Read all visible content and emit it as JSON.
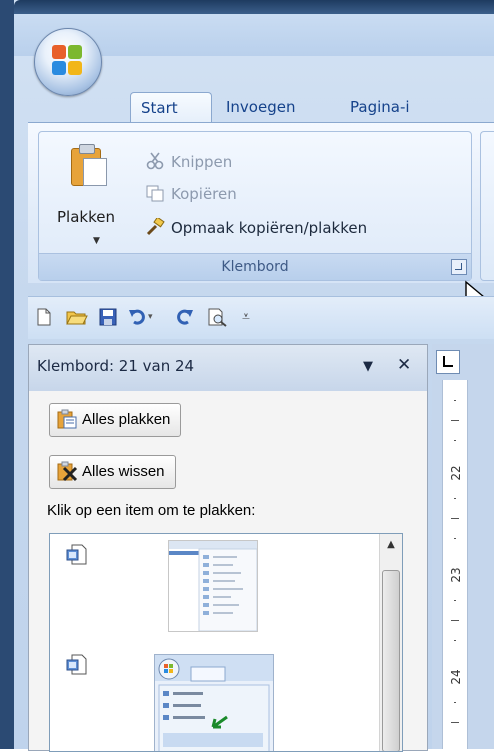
{
  "ribbon": {
    "tabs": [
      {
        "label": "Start",
        "active": true
      },
      {
        "label": "Invoegen",
        "active": false
      },
      {
        "label": "Pagina-i",
        "active": false
      }
    ],
    "clipboard_group": {
      "paste_label": "Plakken",
      "cut_label": "Knippen",
      "copy_label": "Kopiëren",
      "format_painter_label": "Opmaak kopiëren/plakken",
      "group_label": "Klembord"
    }
  },
  "quick_access": {
    "icons": [
      "new-document-icon",
      "open-folder-icon",
      "save-icon",
      "undo-icon",
      "undo-dropdown-icon",
      "redo-icon",
      "print-preview-icon",
      "customize-dropdown-icon"
    ]
  },
  "clipboard_pane": {
    "title": "Klembord: 21 van 24",
    "paste_all_label": "Alles plakken",
    "clear_all_label": "Alles wissen",
    "hint": "Klik op een item om te plakken:",
    "items": [
      {
        "type": "image"
      },
      {
        "type": "image"
      }
    ]
  },
  "ruler": {
    "labels": [
      "22",
      "23",
      "24"
    ]
  },
  "colors": {
    "accent": "#15428b",
    "ribbon_bg": "#dde9f8",
    "window_frame": "#2b4a73"
  }
}
